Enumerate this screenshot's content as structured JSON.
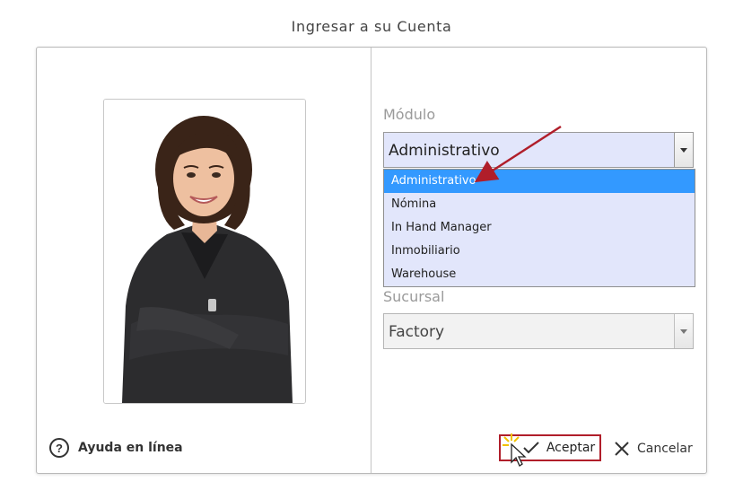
{
  "window": {
    "title": "Ingresar a su Cuenta"
  },
  "help": {
    "label": "Ayuda en línea",
    "icon": "question-circle-icon"
  },
  "module": {
    "label": "Módulo",
    "selected": "Administrativo",
    "options": [
      "Administrativo",
      "Nómina",
      "In Hand Manager",
      "Inmobiliario",
      "Warehouse"
    ],
    "highlighted_index": 0
  },
  "branch": {
    "label": "Sucursal",
    "selected": "Factory"
  },
  "actions": {
    "accept_label": "Aceptar",
    "cancel_label": "Cancelar"
  },
  "colors": {
    "accent_red": "#b01e2a",
    "selection_blue": "#3399ff",
    "dropdown_bg": "#e2e6fb"
  }
}
